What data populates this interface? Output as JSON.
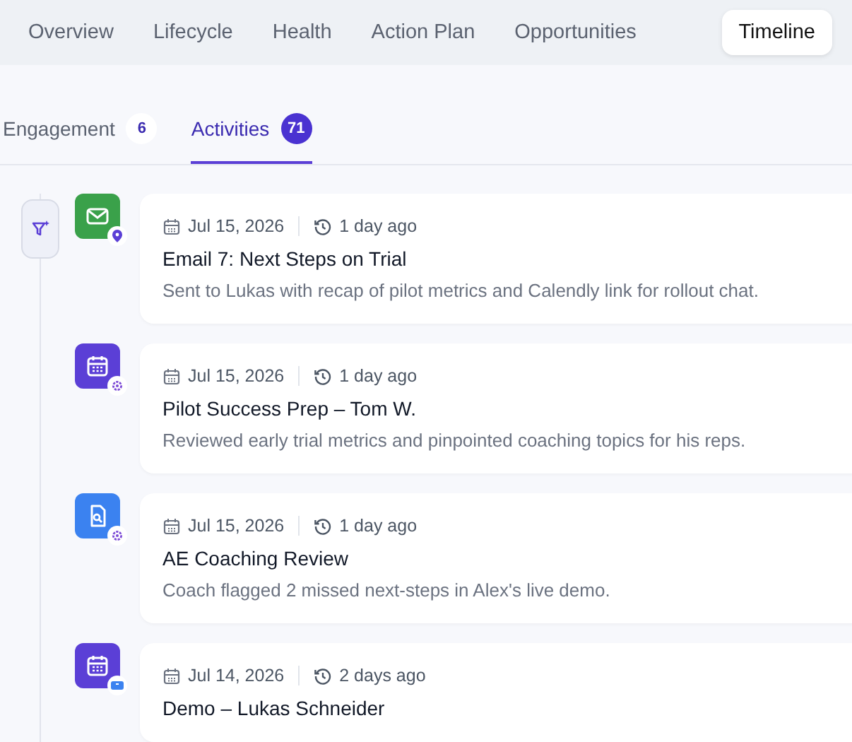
{
  "tabs": [
    {
      "label": "Overview",
      "selected": false
    },
    {
      "label": "Lifecycle",
      "selected": false
    },
    {
      "label": "Health",
      "selected": false
    },
    {
      "label": "Action Plan",
      "selected": false
    },
    {
      "label": "Opportunities",
      "selected": false
    },
    {
      "label": "Timeline",
      "selected": true
    }
  ],
  "subtabs": [
    {
      "label": "Engagement",
      "count": "6",
      "selected": false
    },
    {
      "label": "Activities",
      "count": "71",
      "selected": true
    }
  ],
  "activities": [
    {
      "kind": "email",
      "badge": {
        "kind": "pin"
      },
      "date": "Jul 15, 2026",
      "ago": "1 day ago",
      "title": "Email 7: Next Steps on Trial",
      "description": "Sent to Lukas with recap of pilot metrics and Calendly link for rollout chat."
    },
    {
      "kind": "meeting",
      "badge": {
        "kind": "gear"
      },
      "date": "Jul 15, 2026",
      "ago": "1 day ago",
      "title": "Pilot Success Prep – Tom W.",
      "description": "Reviewed early trial metrics and pinpointed coaching topics for his reps."
    },
    {
      "kind": "review",
      "badge": {
        "kind": "gear"
      },
      "date": "Jul 15, 2026",
      "ago": "1 day ago",
      "title": "AE Coaching Review",
      "description": "Coach flagged 2 missed next-steps in Alex's live demo."
    },
    {
      "kind": "meeting",
      "badge": {
        "kind": "video"
      },
      "date": "Jul 14, 2026",
      "ago": "2 days ago",
      "title": "Demo – Lukas Schneider"
    }
  ]
}
